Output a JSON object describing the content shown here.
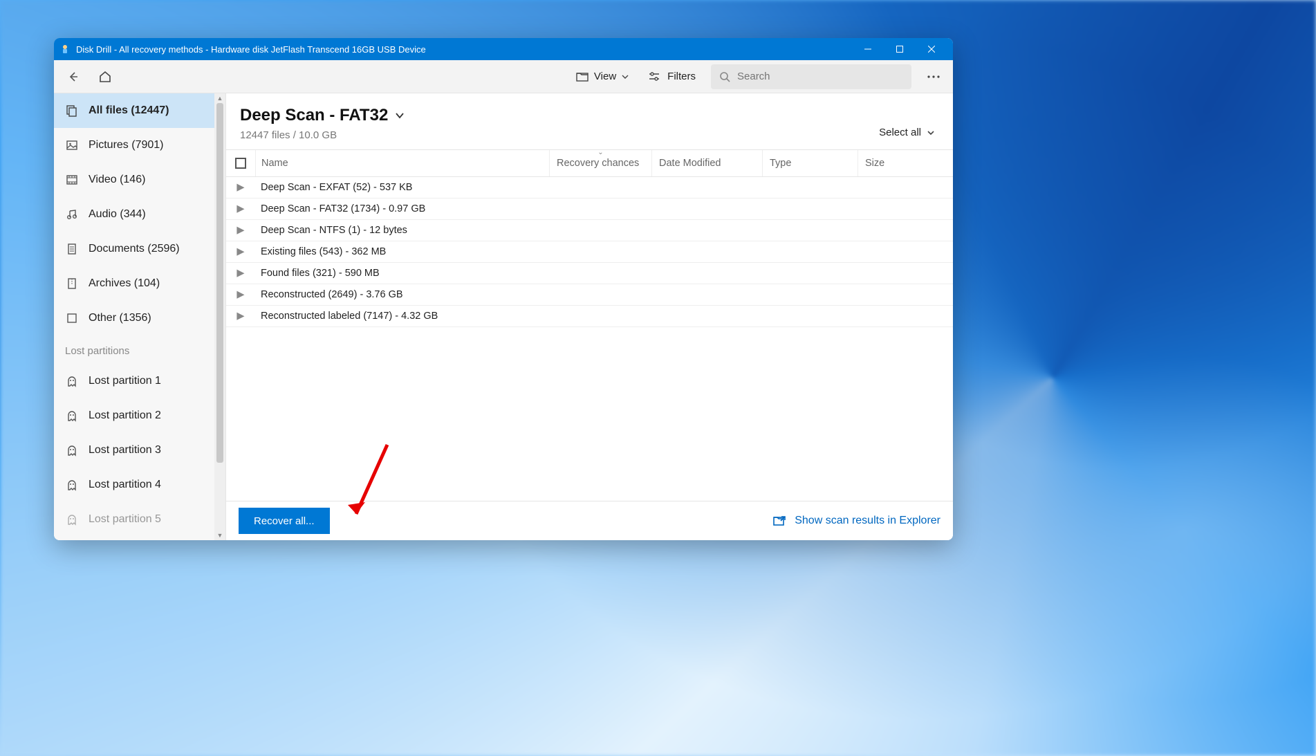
{
  "titlebar": {
    "text": "Disk Drill - All recovery methods - Hardware disk JetFlash Transcend 16GB USB Device"
  },
  "toolbar": {
    "view_label": "View",
    "filters_label": "Filters",
    "search_placeholder": "Search"
  },
  "sidebar": {
    "categories": [
      {
        "label": "All files (12447)",
        "icon": "files"
      },
      {
        "label": "Pictures (7901)",
        "icon": "picture"
      },
      {
        "label": "Video (146)",
        "icon": "video"
      },
      {
        "label": "Audio (344)",
        "icon": "audio"
      },
      {
        "label": "Documents (2596)",
        "icon": "document"
      },
      {
        "label": "Archives (104)",
        "icon": "archive"
      },
      {
        "label": "Other (1356)",
        "icon": "other"
      }
    ],
    "section_label": "Lost partitions",
    "partitions": [
      {
        "label": "Lost partition 1"
      },
      {
        "label": "Lost partition 2"
      },
      {
        "label": "Lost partition 3"
      },
      {
        "label": "Lost partition 4"
      },
      {
        "label": "Lost partition 5"
      }
    ]
  },
  "main": {
    "title": "Deep Scan - FAT32",
    "subtitle": "12447 files / 10.0 GB",
    "select_all_label": "Select all",
    "columns": {
      "name": "Name",
      "recovery": "Recovery chances",
      "date": "Date Modified",
      "type": "Type",
      "size": "Size"
    },
    "rows": [
      {
        "label": "Deep Scan - EXFAT (52) - 537 KB"
      },
      {
        "label": "Deep Scan - FAT32 (1734) - 0.97 GB"
      },
      {
        "label": "Deep Scan - NTFS (1) - 12 bytes"
      },
      {
        "label": "Existing files (543) - 362 MB"
      },
      {
        "label": "Found files (321) - 590 MB"
      },
      {
        "label": "Reconstructed (2649) - 3.76 GB"
      },
      {
        "label": "Reconstructed labeled (7147) - 4.32 GB"
      }
    ]
  },
  "footer": {
    "recover_label": "Recover all...",
    "explorer_label": "Show scan results in Explorer"
  }
}
